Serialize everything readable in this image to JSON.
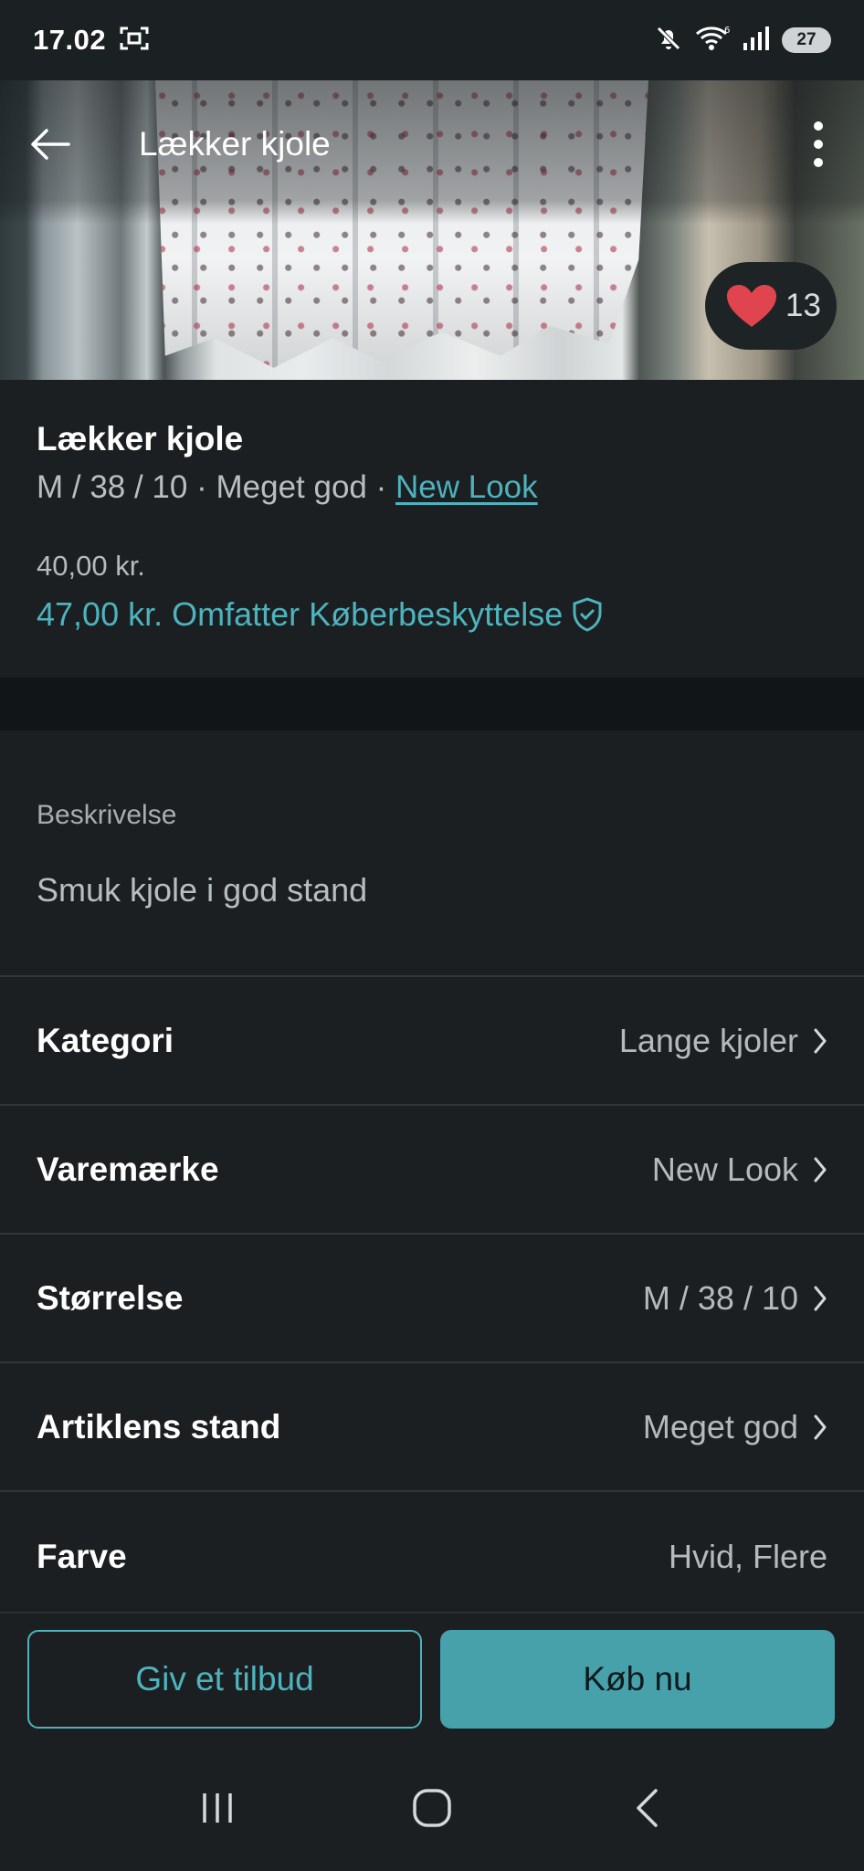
{
  "status_bar": {
    "time": "17.02",
    "battery": "27"
  },
  "toolbar": {
    "title": "Lækker kjole"
  },
  "likes": {
    "count": "13"
  },
  "item": {
    "title": "Lækker kjole",
    "size": "M / 38 / 10",
    "separator": " · ",
    "condition": "Meget god",
    "brand": "New Look",
    "price": "40,00 kr.",
    "total_price": "47,00 kr.",
    "protection_label": "Omfatter Køberbeskyttelse"
  },
  "description": {
    "label": "Beskrivelse",
    "text": "Smuk kjole i god stand"
  },
  "details": [
    {
      "label": "Kategori",
      "value": "Lange kjoler"
    },
    {
      "label": "Varemærke",
      "value": "New Look"
    },
    {
      "label": "Størrelse",
      "value": "M / 38 / 10"
    },
    {
      "label": "Artiklens stand",
      "value": "Meget god"
    },
    {
      "label": "Farve",
      "value": "Hvid, Flere"
    }
  ],
  "actions": {
    "offer_label": "Giv et tilbud",
    "buy_label": "Køb nu"
  },
  "colors": {
    "accent": "#4db3bd",
    "buy_button": "#46a1aa",
    "heart": "#e0444f",
    "background": "#1b1f21"
  }
}
